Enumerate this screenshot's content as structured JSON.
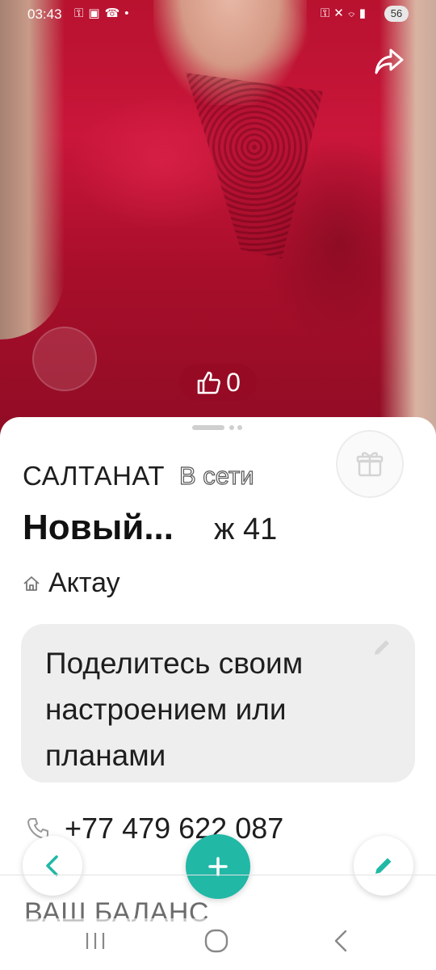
{
  "status_bar": {
    "time": "03:43",
    "battery": "56"
  },
  "photo": {
    "like_count": "0"
  },
  "profile": {
    "name": "САЛТАНАТ",
    "online_status": "В сети",
    "title": "Новый...",
    "age_gender": "ж 41",
    "city": "Актау",
    "mood_placeholder": "Поделитесь своим настроением или планами",
    "phone": "+77 479 622 087",
    "balance_label": "ВАШ БАЛАНС"
  },
  "colors": {
    "accent": "#21b8a6",
    "dress": "#b8122f"
  },
  "icons": {
    "share": "share-icon",
    "like": "thumbs-up-icon",
    "gift": "gift-icon",
    "home": "home-icon",
    "phone": "phone-icon",
    "edit": "pencil-icon",
    "back": "chevron-left-icon",
    "add": "plus-icon"
  }
}
